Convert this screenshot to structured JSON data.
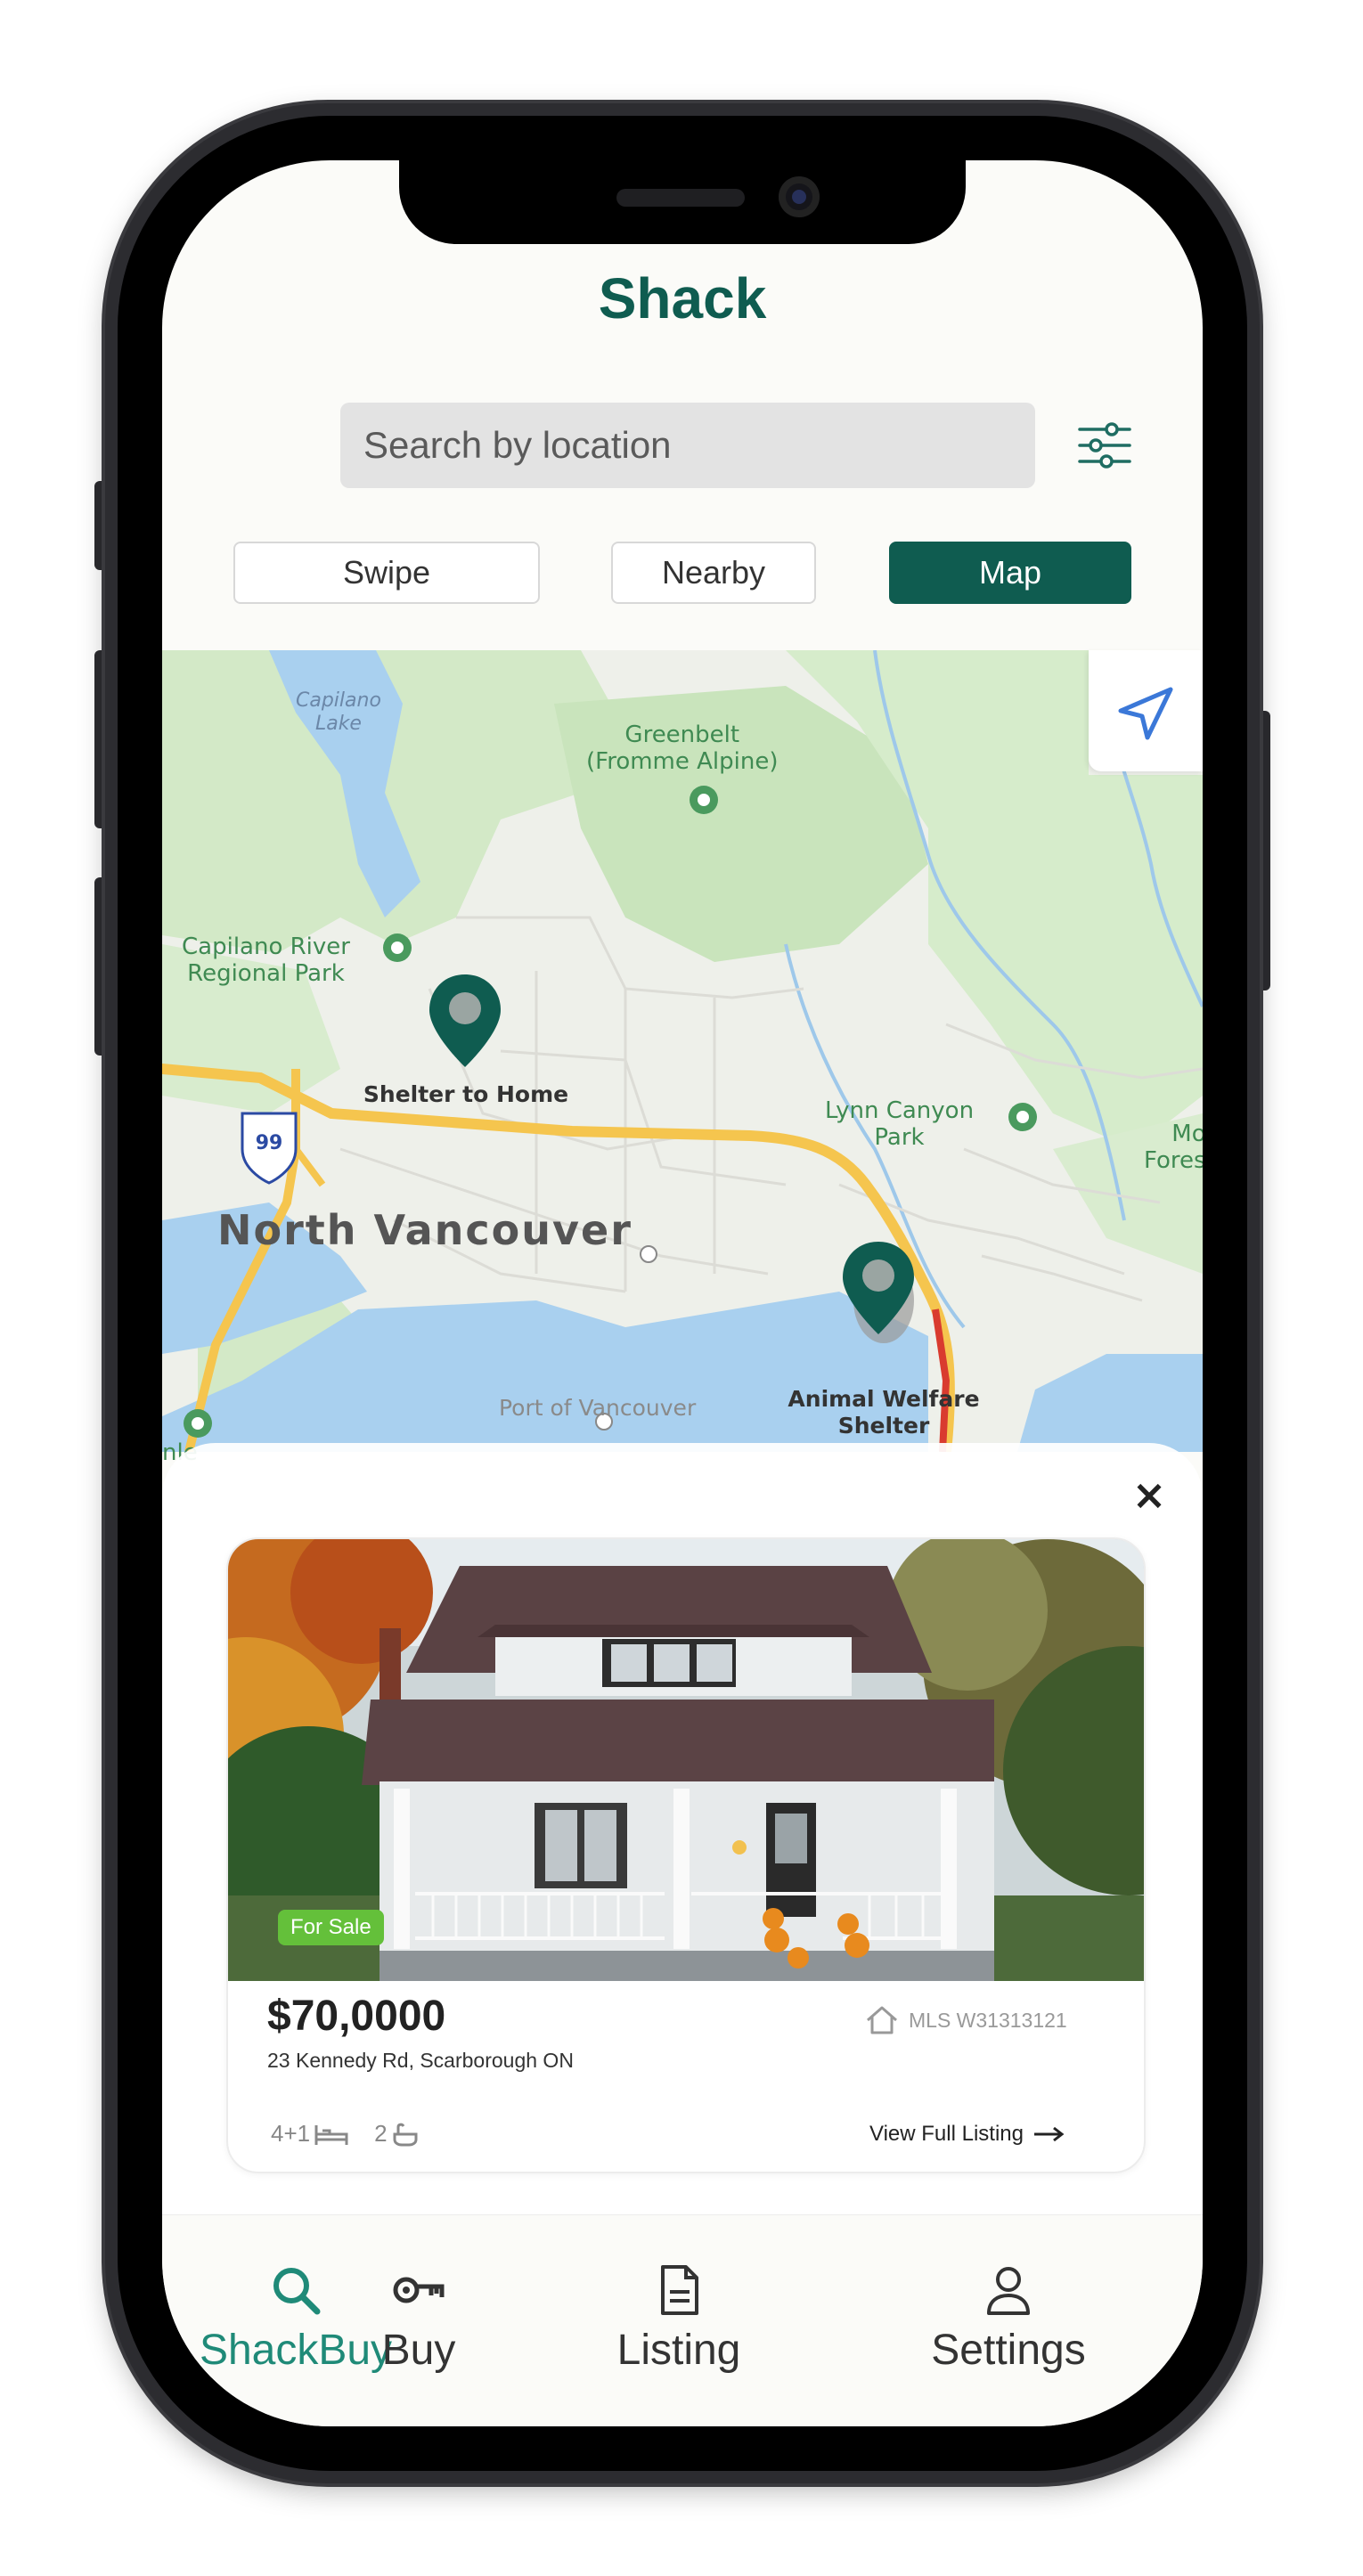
{
  "app": {
    "title": "Shack"
  },
  "search": {
    "placeholder": "Search by location"
  },
  "view_toggle": {
    "swipe": "Swipe",
    "nearby": "Nearby",
    "map": "Map",
    "selected": "Map"
  },
  "map": {
    "labels": {
      "capilano_lake": "Capilano\nLake",
      "greenbelt": "Greenbelt\n(Fromme Alpine)",
      "capilano_river_park": "Capilano River\nRegional Park",
      "lynn_canyon_park": "Lynn Canyon\nPark",
      "mo_forest": "Mo\nFores",
      "north_vancouver": "North Vancouver",
      "port_of_vancouver": "Port of Vancouver",
      "highway_shield": "99",
      "edge_label": "nle"
    },
    "pins": [
      {
        "name": "Shelter to Home"
      },
      {
        "name": "Animal Welfare\nShelter"
      }
    ]
  },
  "listing": {
    "badge": "For Sale",
    "price": "$70,0000",
    "address": "23 Kennedy Rd, Scarborough ON",
    "mls": "MLS W31313121",
    "beds": "4+1",
    "baths": "2",
    "view_link": "View Full Listing"
  },
  "nav": {
    "search": "ShackBuy",
    "buy": "Buy",
    "listing": "Listing",
    "settings": "Settings",
    "active": "ShackBuy"
  },
  "colors": {
    "brand": "#0f5c50",
    "nav_active": "#1f8a78",
    "badge": "#64c03a",
    "road": "#f5c54e",
    "water": "#a9d0ef",
    "park": "#cfe8c3"
  }
}
